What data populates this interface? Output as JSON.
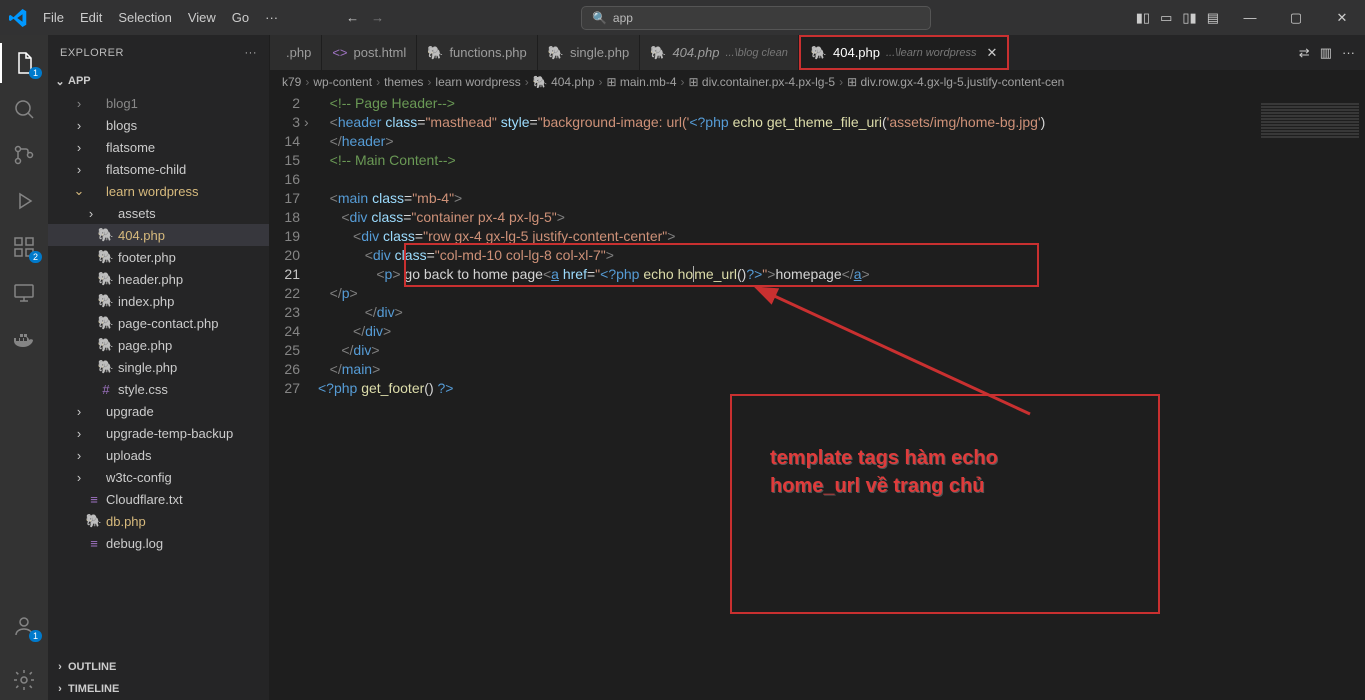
{
  "menu": {
    "file": "File",
    "edit": "Edit",
    "selection": "Selection",
    "view": "View",
    "go": "Go",
    "more": "···"
  },
  "commandCenter": {
    "icon": "🔍",
    "text": "app"
  },
  "winControls": {
    "min": "—",
    "max": "▢",
    "close": "✕"
  },
  "activity": {
    "badges": {
      "explorer": "1",
      "ext": "2",
      "account": "1"
    }
  },
  "explorer": {
    "title": "EXPLORER",
    "more": "···",
    "root": "APP"
  },
  "tree": [
    {
      "indent": 2,
      "tw": "›",
      "ic": "",
      "label": "blog1",
      "dim": true
    },
    {
      "indent": 2,
      "tw": "›",
      "ic": "",
      "label": "blogs"
    },
    {
      "indent": 2,
      "tw": "›",
      "ic": "",
      "label": "flatsome"
    },
    {
      "indent": 2,
      "tw": "›",
      "ic": "",
      "label": "flatsome-child"
    },
    {
      "indent": 2,
      "tw": "⌄",
      "ic": "",
      "label": "learn wordpress",
      "mod": true
    },
    {
      "indent": 3,
      "tw": "›",
      "ic": "",
      "label": "assets"
    },
    {
      "indent": 3,
      "tw": "",
      "ic": "🐘",
      "label": "404.php",
      "sel": true,
      "mod": true
    },
    {
      "indent": 3,
      "tw": "",
      "ic": "🐘",
      "label": "footer.php"
    },
    {
      "indent": 3,
      "tw": "",
      "ic": "🐘",
      "label": "header.php"
    },
    {
      "indent": 3,
      "tw": "",
      "ic": "🐘",
      "label": "index.php"
    },
    {
      "indent": 3,
      "tw": "",
      "ic": "🐘",
      "label": "page-contact.php"
    },
    {
      "indent": 3,
      "tw": "",
      "ic": "🐘",
      "label": "page.php"
    },
    {
      "indent": 3,
      "tw": "",
      "ic": "🐘",
      "label": "single.php"
    },
    {
      "indent": 3,
      "tw": "",
      "ic": "#",
      "label": "style.css"
    },
    {
      "indent": 2,
      "tw": "›",
      "ic": "",
      "label": "upgrade"
    },
    {
      "indent": 2,
      "tw": "›",
      "ic": "",
      "label": "upgrade-temp-backup"
    },
    {
      "indent": 2,
      "tw": "›",
      "ic": "",
      "label": "uploads"
    },
    {
      "indent": 2,
      "tw": "›",
      "ic": "",
      "label": "w3tc-config"
    },
    {
      "indent": 2,
      "tw": "",
      "ic": "≡",
      "label": "Cloudflare.txt"
    },
    {
      "indent": 2,
      "tw": "",
      "ic": "🐘",
      "label": "db.php",
      "mod": true
    },
    {
      "indent": 2,
      "tw": "",
      "ic": "≡",
      "label": "debug.log"
    }
  ],
  "outline": "OUTLINE",
  "timeline": "TIMELINE",
  "tabs": [
    {
      "ic": "",
      "label": ".php",
      "sub": "",
      "active": false
    },
    {
      "ic": "<>",
      "label": "post.html",
      "sub": ""
    },
    {
      "ic": "🐘",
      "label": "functions.php",
      "sub": ""
    },
    {
      "ic": "🐘",
      "label": "single.php",
      "sub": ""
    },
    {
      "ic": "🐘",
      "label": "404.php",
      "sub": "...\\blog clean",
      "italic": true
    },
    {
      "ic": "🐘",
      "label": "404.php",
      "sub": "...\\learn wordpress",
      "active": true,
      "red": true,
      "close": "✕"
    }
  ],
  "tabActions": {
    "compare": "⇄",
    "split": "▥",
    "more": "···"
  },
  "breadcrumb": [
    "k79",
    "wp-content",
    "themes",
    "learn wordpress",
    "🐘 404.php",
    "⊞ main.mb-4",
    "⊞ div.container.px-4.px-lg-5",
    "⊞ div.row.gx-4.gx-lg-5.justify-content-cen"
  ],
  "lineStart": 2,
  "currentLine": 21,
  "code": [
    {
      "n": 2,
      "html": "   <span class='c-cm'>&lt;!-- Page Header--&gt;</span>"
    },
    {
      "n": 3,
      "html": "   <span class='c-tag'>&lt;</span><span class='c-el'>header</span> <span class='c-attr'>class</span>=<span class='c-str'>\"masthead\"</span> <span class='c-attr'>style</span>=<span class='c-str'>\"background-image: url('</span><span class='c-php'>&lt;?php</span> <span class='c-fn'>echo</span> <span class='c-fn'>get_theme_file_uri</span>(<span class='c-str'>'assets/img/home-bg.jpg'</span>)"
    },
    {
      "n": 14,
      "html": "   <span class='c-tag'>&lt;/</span><span class='c-el'>header</span><span class='c-tag'>&gt;</span>"
    },
    {
      "n": 15,
      "html": "   <span class='c-cm'>&lt;!-- Main Content--&gt;</span>"
    },
    {
      "n": 16,
      "html": ""
    },
    {
      "n": 17,
      "html": "   <span class='c-tag'>&lt;</span><span class='c-el'>main</span> <span class='c-attr'>class</span>=<span class='c-str'>\"mb-4\"</span><span class='c-tag'>&gt;</span>"
    },
    {
      "n": 18,
      "html": "      <span class='c-tag'>&lt;</span><span class='c-el'>div</span> <span class='c-attr'>class</span>=<span class='c-str'>\"container px-4 px-lg-5\"</span><span class='c-tag'>&gt;</span>"
    },
    {
      "n": 19,
      "html": "         <span class='c-tag'>&lt;</span><span class='c-el'>div</span> <span class='c-attr'>class</span>=<span class='c-str'>\"row gx-4 gx-lg-5 justify-content-center\"</span><span class='c-tag'>&gt;</span>"
    },
    {
      "n": 20,
      "html": "            <span class='c-tag'>&lt;</span><span class='c-el'>div</span> <span class='c-attr'>class</span>=<span class='c-str'>\"col-md-10 col-lg-8 col-xl-7\"</span><span class='c-tag'>&gt;</span>"
    },
    {
      "n": 21,
      "html": "               <span class='c-tag'>&lt;</span><span class='c-el'>p</span><span class='c-tag'>&gt;</span> go back to home page<span class='c-tag'>&lt;</span><span class='c-el'><u>a</u></span> <span class='c-attr'>href</span>=<span class='c-str'>\"</span><span class='c-php'>&lt;?php</span> <span class='c-fn'>echo</span> <span class='c-fn'>ho<span style='border-left:1px solid #aeafad'>m</span>e_url</span>()<span class='c-php'>?&gt;</span><span class='c-str'>\"</span><span class='c-tag'>&gt;</span>homepage<span class='c-tag'>&lt;/</span><span class='c-el'><u>a</u></span><span class='c-tag'>&gt;</span>"
    },
    {
      "n": 22,
      "html": "   <span class='c-tag'>&lt;/</span><span class='c-el'>p</span><span class='c-tag'>&gt;</span>"
    },
    {
      "n": 23,
      "html": "            <span class='c-tag'>&lt;/</span><span class='c-el'>div</span><span class='c-tag'>&gt;</span>"
    },
    {
      "n": 24,
      "html": "         <span class='c-tag'>&lt;/</span><span class='c-el'>div</span><span class='c-tag'>&gt;</span>"
    },
    {
      "n": 25,
      "html": "      <span class='c-tag'>&lt;/</span><span class='c-el'>div</span><span class='c-tag'>&gt;</span>"
    },
    {
      "n": 26,
      "html": "   <span class='c-tag'>&lt;/</span><span class='c-el'>main</span><span class='c-tag'>&gt;</span>"
    },
    {
      "n": 27,
      "html": "<span class='c-php'>&lt;?php</span> <span class='c-fn'>get_footer</span>() <span class='c-php'>?&gt;</span>"
    }
  ],
  "annotation": {
    "line1": "template tags hàm echo",
    "line2": "home_url   về trang chủ"
  }
}
